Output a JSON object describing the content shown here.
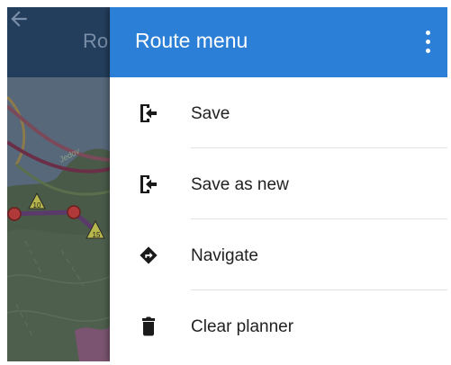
{
  "map": {
    "title": "Ro",
    "marker_labels": [
      "10",
      "15"
    ],
    "street_label": "Jedov"
  },
  "drawer": {
    "title": "Route menu",
    "header_color": "#2b7fd6",
    "items": [
      {
        "label": "Save",
        "icon": "save-icon"
      },
      {
        "label": "Save as new",
        "icon": "save-as-new-icon"
      },
      {
        "label": "Navigate",
        "icon": "navigate-icon"
      },
      {
        "label": "Clear planner",
        "icon": "trash-icon"
      }
    ]
  }
}
